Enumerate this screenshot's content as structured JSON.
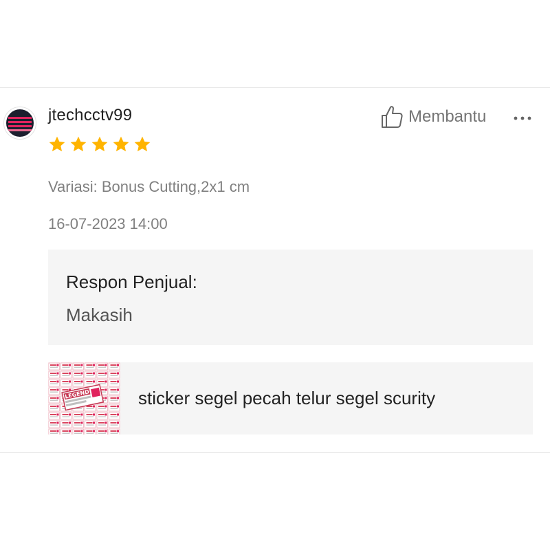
{
  "review": {
    "username": "jtechcctv99",
    "rating": 5,
    "rating_max": 5,
    "helpful_label": "Membantu",
    "variation": "Variasi: Bonus Cutting,2x1 cm",
    "timestamp": "16-07-2023 14:00"
  },
  "seller_response": {
    "title": "Respon Penjual:",
    "message": "Makasih"
  },
  "product": {
    "name": "sticker segel pecah telur segel scurity",
    "thumbnail_text": "LEGEND"
  },
  "icons": {
    "star": "star-icon",
    "thumb": "thumbs-up-icon",
    "more": "more-options-icon"
  },
  "colors": {
    "star": "#FFB400",
    "text_primary": "#222222",
    "text_secondary": "#808080",
    "panel_bg": "#F5F5F5",
    "avatar_accent": "#E0245E"
  }
}
